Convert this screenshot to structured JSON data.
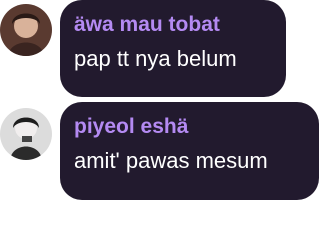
{
  "messages": [
    {
      "author": "äwa mau tobat",
      "text": "pap tt nya belum",
      "avatar_icon": "user-avatar-1"
    },
    {
      "author": "piyeol eshä",
      "text": "amit' pawas mesum",
      "avatar_icon": "user-avatar-2"
    }
  ],
  "colors": {
    "bubble": "#221a2e",
    "author": "#b48af2",
    "text": "#ffffff"
  }
}
